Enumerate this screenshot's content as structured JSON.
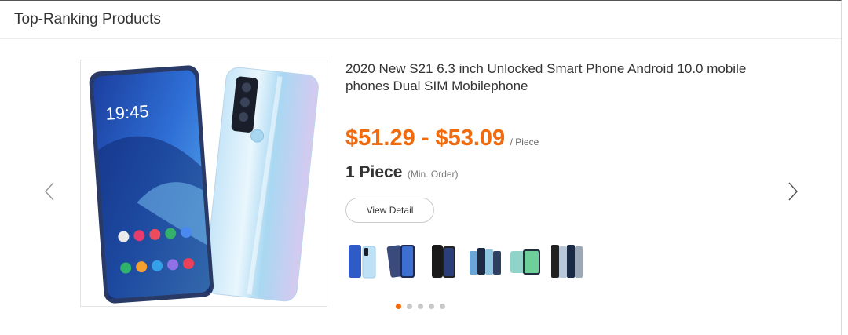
{
  "section": {
    "title": "Top-Ranking Products"
  },
  "product": {
    "title": "2020 New S21 6.3 inch Unlocked Smart Phone Android 10.0 mobile phones Dual SIM Mobilephone",
    "price_range": "$51.29 - $53.09",
    "price_unit": "/ Piece",
    "min_order_qty": "1 Piece",
    "min_order_label": "(Min. Order)",
    "detail_button": "View Detail",
    "screen_time": "19:45",
    "image_alt": "smartphone-front-and-back"
  },
  "thumbnails": [
    {
      "name": "thumb-1",
      "icon": "phone-blue-gradient"
    },
    {
      "name": "thumb-2",
      "icon": "phone-dark-pair"
    },
    {
      "name": "thumb-3",
      "icon": "phone-black-pair"
    },
    {
      "name": "thumb-4",
      "icon": "phone-group"
    },
    {
      "name": "thumb-5",
      "icon": "phone-green-pair"
    },
    {
      "name": "thumb-6",
      "icon": "phone-group-silver"
    }
  ],
  "carousel": {
    "page_count": 5,
    "active_page": 1
  },
  "colors": {
    "accent": "#f06b0e",
    "dot_inactive": "#c8c8c8",
    "border": "#e3e3e3"
  }
}
